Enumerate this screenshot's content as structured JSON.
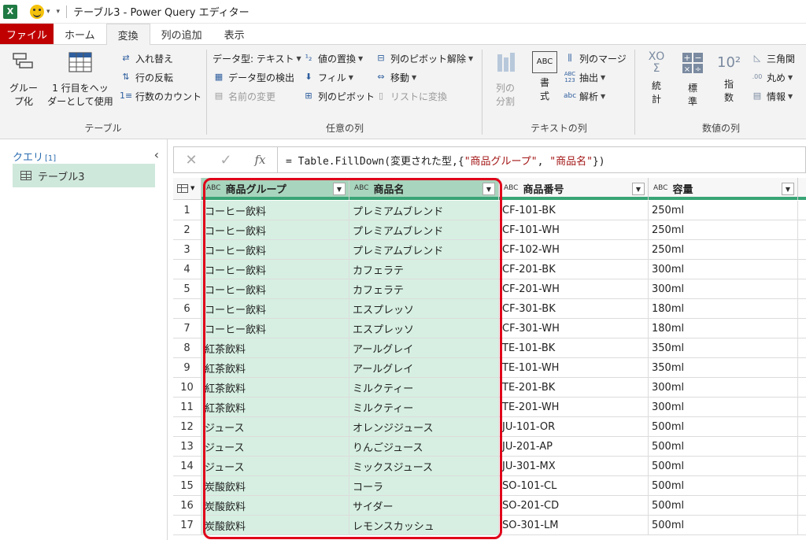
{
  "titlebar": {
    "app_icon": "X",
    "title": "テーブル3 - Power Query エディター"
  },
  "tabs": [
    {
      "label": "ファイル"
    },
    {
      "label": "ホーム"
    },
    {
      "label": "変換"
    },
    {
      "label": "列の追加"
    },
    {
      "label": "表示"
    }
  ],
  "ribbon": {
    "table_group": {
      "label": "テーブル",
      "group_by": "グルー\nプ化",
      "use_first_row": "1 行目をヘッ\nダーとして使用",
      "transpose": "入れ替え",
      "reverse_rows": "行の反転",
      "count_rows": "行数のカウント"
    },
    "any_column_group": {
      "label": "任意の列",
      "data_type": "データ型: テキスト",
      "detect_type": "データ型の検出",
      "rename": "名前の変更",
      "replace_values": "値の置換",
      "fill": "フィル",
      "pivot": "列のピボット",
      "unpivot": "列のピボット解除",
      "move": "移動",
      "to_list": "リストに変換"
    },
    "text_group": {
      "label": "テキストの列",
      "split": "列の\n分割",
      "format": "書\n式",
      "merge": "列のマージ",
      "extract": "抽出",
      "parse": "解析",
      "abc_label": "ABC",
      "abc123_label": "ABC\n123",
      "abc_small": "abc"
    },
    "number_group": {
      "label": "数値の列",
      "statistics": "統\n計",
      "standard": "標\n準",
      "scientific": "指\n数",
      "sigma": "XΟ\nΣ",
      "ten_squared": "10²",
      "trig": "三角関",
      "rounding": "丸め",
      "info": "情報"
    }
  },
  "querypane": {
    "title": "クエリ",
    "count": "[1]",
    "items": [
      {
        "label": "テーブル3"
      }
    ]
  },
  "formula": {
    "fx": "fx",
    "prefix": "= Table.FillDown(変更された型,{",
    "arg1": "\"商品グループ\"",
    "comma": ", ",
    "arg2": "\"商品名\"",
    "suffix": "})"
  },
  "grid": {
    "columns": [
      {
        "name": "商品グループ",
        "type": "ABC"
      },
      {
        "name": "商品名",
        "type": "ABC"
      },
      {
        "name": "商品番号",
        "type": "ABC"
      },
      {
        "name": "容量",
        "type": "ABC"
      }
    ],
    "rows": [
      {
        "n": "1",
        "group": "コーヒー飲料",
        "product": "プレミアムブレンド",
        "code": "CF-101-BK",
        "size": "250ml"
      },
      {
        "n": "2",
        "group": "コーヒー飲料",
        "product": "プレミアムブレンド",
        "code": "CF-101-WH",
        "size": "250ml"
      },
      {
        "n": "3",
        "group": "コーヒー飲料",
        "product": "プレミアムブレンド",
        "code": "CF-102-WH",
        "size": "250ml"
      },
      {
        "n": "4",
        "group": "コーヒー飲料",
        "product": "カフェラテ",
        "code": "CF-201-BK",
        "size": "300ml"
      },
      {
        "n": "5",
        "group": "コーヒー飲料",
        "product": "カフェラテ",
        "code": "CF-201-WH",
        "size": "300ml"
      },
      {
        "n": "6",
        "group": "コーヒー飲料",
        "product": "エスプレッソ",
        "code": "CF-301-BK",
        "size": "180ml"
      },
      {
        "n": "7",
        "group": "コーヒー飲料",
        "product": "エスプレッソ",
        "code": "CF-301-WH",
        "size": "180ml"
      },
      {
        "n": "8",
        "group": "紅茶飲料",
        "product": "アールグレイ",
        "code": "TE-101-BK",
        "size": "350ml"
      },
      {
        "n": "9",
        "group": "紅茶飲料",
        "product": "アールグレイ",
        "code": "TE-101-WH",
        "size": "350ml"
      },
      {
        "n": "10",
        "group": "紅茶飲料",
        "product": "ミルクティー",
        "code": "TE-201-BK",
        "size": "300ml"
      },
      {
        "n": "11",
        "group": "紅茶飲料",
        "product": "ミルクティー",
        "code": "TE-201-WH",
        "size": "300ml"
      },
      {
        "n": "12",
        "group": "ジュース",
        "product": "オレンジジュース",
        "code": "JU-101-OR",
        "size": "500ml"
      },
      {
        "n": "13",
        "group": "ジュース",
        "product": "りんごジュース",
        "code": "JU-201-AP",
        "size": "500ml"
      },
      {
        "n": "14",
        "group": "ジュース",
        "product": "ミックスジュース",
        "code": "JU-301-MX",
        "size": "500ml"
      },
      {
        "n": "15",
        "group": "炭酸飲料",
        "product": "コーラ",
        "code": "SO-101-CL",
        "size": "500ml"
      },
      {
        "n": "16",
        "group": "炭酸飲料",
        "product": "サイダー",
        "code": "SO-201-CD",
        "size": "500ml"
      },
      {
        "n": "17",
        "group": "炭酸飲料",
        "product": "レモンスカッシュ",
        "code": "SO-301-LM",
        "size": "500ml"
      }
    ]
  },
  "colors": {
    "file_tab": "#c00000",
    "selected_header": "#a8d5bd",
    "selected_cell": "#d6efe2",
    "highlight_box": "#e0001a"
  }
}
